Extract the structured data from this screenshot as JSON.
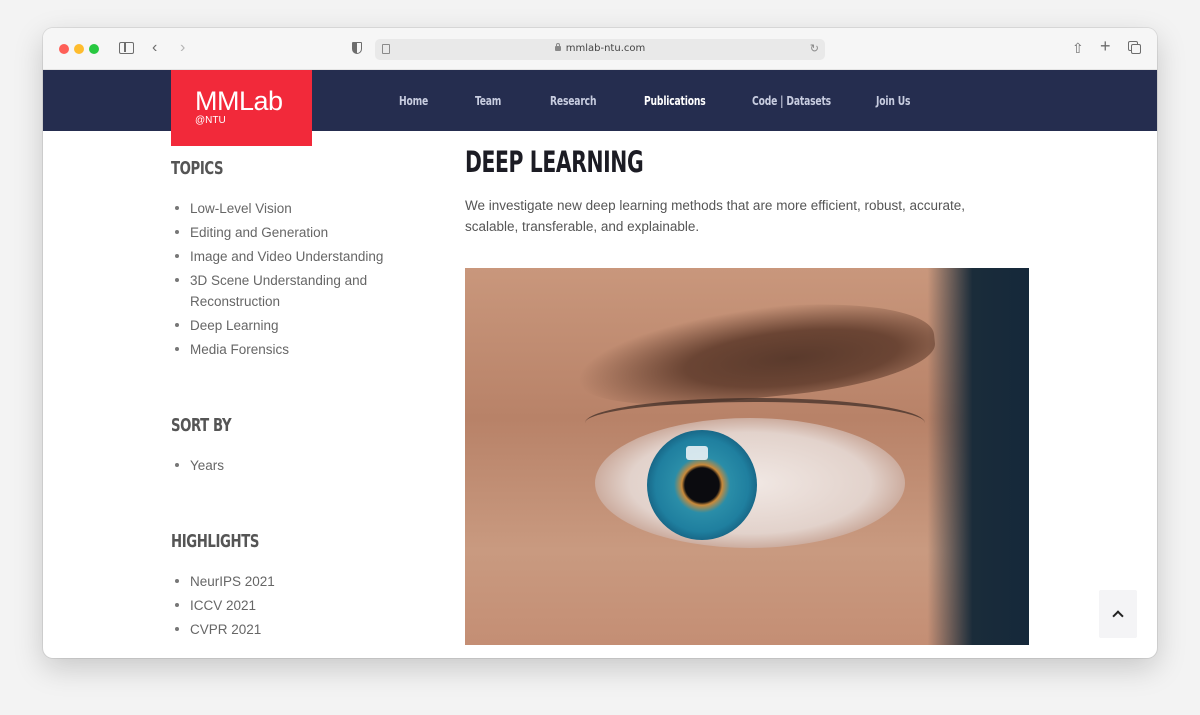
{
  "browser": {
    "url": "mmlab-ntu.com",
    "icons": {
      "sidebar": "sidebar-icon",
      "back": "chevron-left-icon",
      "forward": "chevron-right-icon",
      "privacy": "shield-icon",
      "reader": "reader-icon",
      "lock": "lock-icon",
      "reload": "reload-icon",
      "share": "share-icon",
      "new_tab": "plus-icon",
      "tabs": "tabs-overview-icon"
    },
    "glyphs": {
      "back": "‹",
      "forward": "›",
      "reload": "↻",
      "share": "⇧",
      "new_tab": "+"
    }
  },
  "site": {
    "logo": {
      "main": "MMLab",
      "sub": "@NTU"
    },
    "brand_color": "#f2293a",
    "header_color": "#252d4f",
    "nav": [
      {
        "label": "Home",
        "active": false
      },
      {
        "label": "Team",
        "active": false
      },
      {
        "label": "Research",
        "active": false
      },
      {
        "label": "Publications",
        "active": true
      },
      {
        "label": "Code | Datasets",
        "active": false
      },
      {
        "label": "Join Us",
        "active": false
      }
    ]
  },
  "sidebar": {
    "topics": {
      "heading": "TOPICS",
      "items": [
        "Low-Level Vision",
        "Editing and Generation",
        "Image and Video Understanding",
        "3D Scene Understanding and Reconstruction",
        "Deep Learning",
        "Media Forensics"
      ]
    },
    "sort_by": {
      "heading": "SORT BY",
      "items": [
        "Years"
      ]
    },
    "highlights": {
      "heading": "HIGHLIGHTS",
      "items": [
        "NeurIPS 2021",
        "ICCV 2021",
        "CVPR 2021"
      ]
    }
  },
  "main": {
    "title": "DEEP LEARNING",
    "description": "We investigate new deep learning methods that are more efficient, robust, accurate, scalable, transferable, and explainable.",
    "hero_image": "close-up photo of a blue human eye"
  },
  "back_to_top": {
    "icon": "chevron-up-icon"
  }
}
